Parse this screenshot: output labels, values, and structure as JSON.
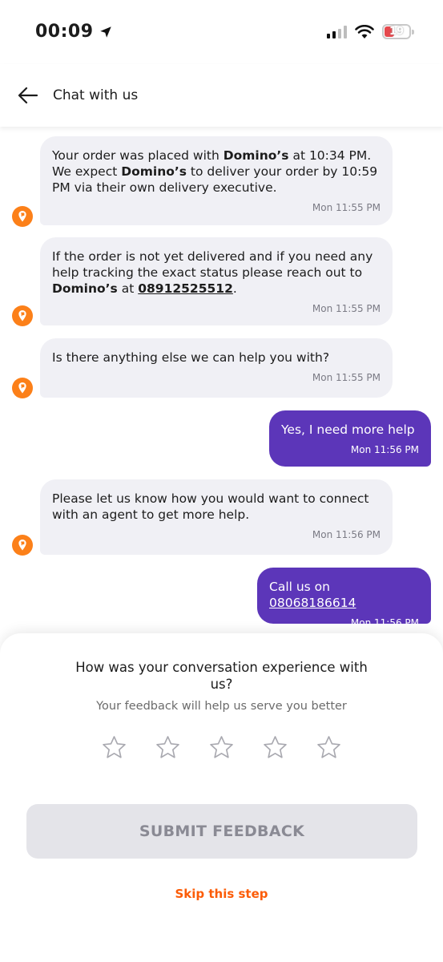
{
  "status_bar": {
    "time": "00:09",
    "battery": "19"
  },
  "header": {
    "title": "Chat with us"
  },
  "messages": [
    {
      "sender": "bot",
      "segments": [
        {
          "text": "Your order was placed with ",
          "style": "normal"
        },
        {
          "text": "Domino’s",
          "style": "bold"
        },
        {
          "text": " at 10:34 PM. We expect ",
          "style": "normal"
        },
        {
          "text": "Domino’s",
          "style": "bold"
        },
        {
          "text": " to deliver your order by 10:59 PM via their own delivery executive.",
          "style": "normal"
        }
      ],
      "time": "Mon 11:55 PM"
    },
    {
      "sender": "bot",
      "segments": [
        {
          "text": "If the order is not yet delivered and if you need any help tracking the exact status please reach out to ",
          "style": "normal"
        },
        {
          "text": "Domino’s",
          "style": "bold"
        },
        {
          "text": " at ",
          "style": "normal"
        },
        {
          "text": "08912525512",
          "style": "link"
        },
        {
          "text": ".",
          "style": "normal"
        }
      ],
      "time": "Mon 11:55 PM"
    },
    {
      "sender": "bot",
      "segments": [
        {
          "text": "Is there anything else we can help you with?",
          "style": "normal"
        }
      ],
      "time": "Mon 11:55 PM"
    },
    {
      "sender": "user",
      "segments": [
        {
          "text": "Yes, I need more help",
          "style": "normal"
        }
      ],
      "time": "Mon 11:56 PM"
    },
    {
      "sender": "bot",
      "segments": [
        {
          "text": "Please let us know how you would want to connect with an agent to get more help.",
          "style": "normal"
        }
      ],
      "time": "Mon 11:56 PM"
    },
    {
      "sender": "user",
      "segments": [
        {
          "text": "Call us on",
          "style": "normal"
        },
        {
          "text": " 08068186614",
          "style": "link"
        }
      ],
      "time": "Mon 11:56 PM"
    }
  ],
  "feedback": {
    "title": "How was your conversation experience with us?",
    "subtitle": "Your feedback will help us serve you better",
    "rating_max": 5,
    "rating_value": 0,
    "submit_label": "SUBMIT FEEDBACK",
    "skip_label": "Skip this step"
  },
  "colors": {
    "accent": "#fc8019",
    "user_bubble": "#5c36b9",
    "bot_bubble": "#f0f0f5",
    "skip_link": "#fc5c07"
  },
  "icons": {
    "back": "arrow-left-icon",
    "bot_avatar": "swiggy-logo-icon",
    "star": "star-outline-icon",
    "location": "location-arrow-icon",
    "wifi": "wifi-icon",
    "signal": "cellular-signal-icon",
    "battery": "battery-icon"
  }
}
